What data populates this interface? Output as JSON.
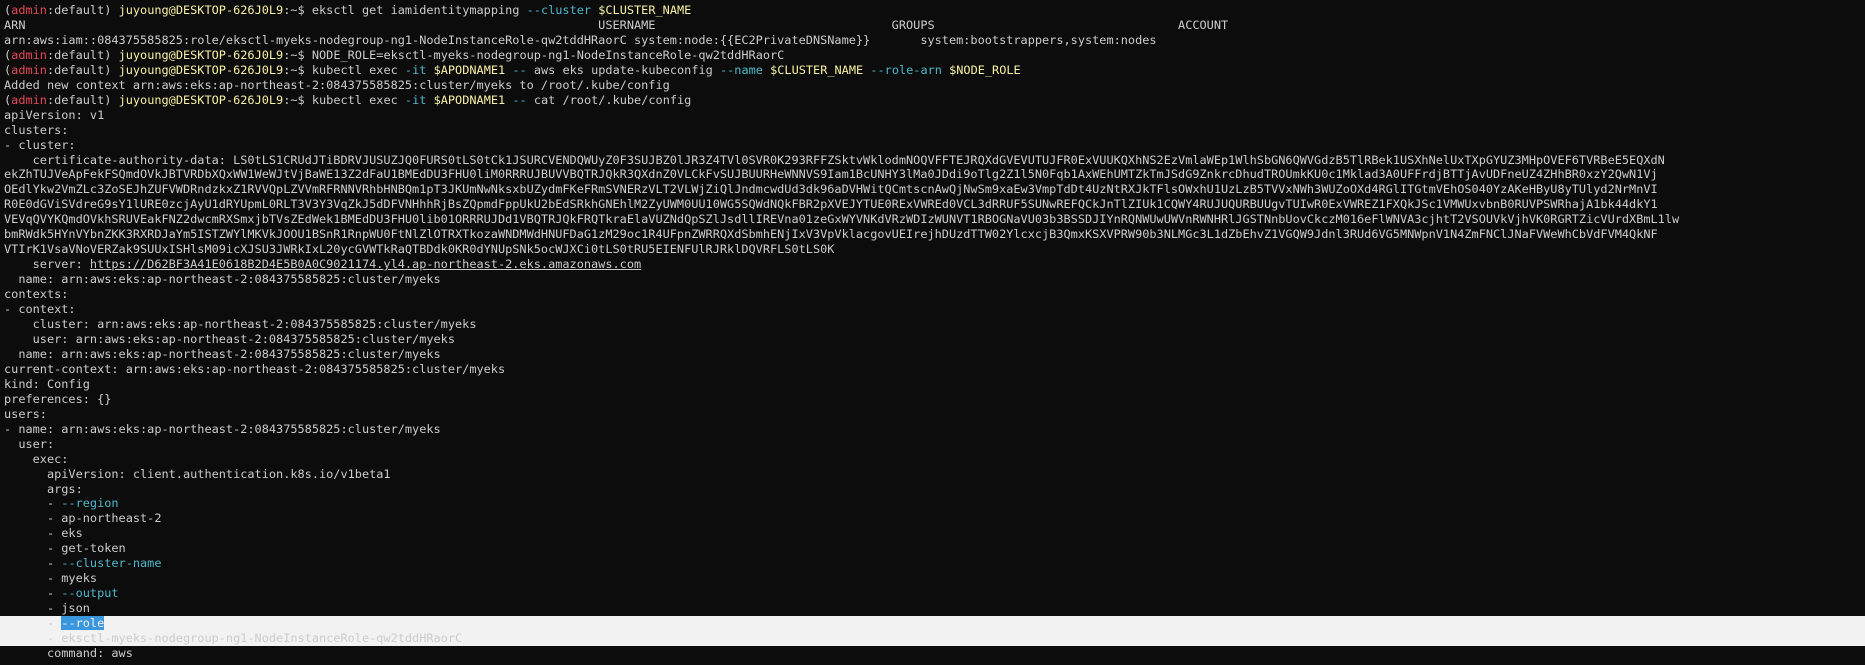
{
  "terminal": {
    "colors": {
      "background": "#0c0c0c",
      "foreground": "#cccccc",
      "prompt_env": "#e74856",
      "prompt_user": "#f9f1a5",
      "variable": "#f9f1a5",
      "flag": "#3a96dd",
      "selection": "#f2f2f2"
    },
    "lines": [
      {
        "segs": [
          {
            "t": "(",
            "c": "grey"
          },
          {
            "t": "admin",
            "c": "red"
          },
          {
            "t": ":default) ",
            "c": "grey"
          },
          {
            "t": "juyoung@DESKTOP-626J0L9",
            "c": "yellow"
          },
          {
            "t": ":~$ eksctl get iamidentitymapping ",
            "c": "grey"
          },
          {
            "t": "--cluster",
            "c": "teal"
          },
          {
            "t": " ",
            "c": "grey"
          },
          {
            "t": "$CLUSTER_NAME",
            "c": "yellow"
          }
        ]
      },
      {
        "segs": [
          {
            "t": "ARN                                                                                USERNAME                                 GROUPS                                  ACCOUNT",
            "c": "grey"
          }
        ]
      },
      {
        "segs": [
          {
            "t": "arn:aws:iam::084375585825:role/eksctl-myeks-nodegroup-ng1-NodeInstanceRole-qw2tddHRaorC system:node:{{EC2PrivateDNSName}}       system:bootstrappers,system:nodes",
            "c": "grey"
          }
        ]
      },
      {
        "segs": [
          {
            "t": "(",
            "c": "grey"
          },
          {
            "t": "admin",
            "c": "red"
          },
          {
            "t": ":default) ",
            "c": "grey"
          },
          {
            "t": "juyoung@DESKTOP-626J0L9",
            "c": "yellow"
          },
          {
            "t": ":~$ NODE_ROLE=eksctl-myeks-nodegroup-ng1-NodeInstanceRole-qw2tddHRaorC",
            "c": "grey"
          }
        ]
      },
      {
        "segs": [
          {
            "t": "(",
            "c": "grey"
          },
          {
            "t": "admin",
            "c": "red"
          },
          {
            "t": ":default) ",
            "c": "grey"
          },
          {
            "t": "juyoung@DESKTOP-626J0L9",
            "c": "yellow"
          },
          {
            "t": ":~$ kubectl exec ",
            "c": "grey"
          },
          {
            "t": "-it",
            "c": "teal"
          },
          {
            "t": " ",
            "c": "grey"
          },
          {
            "t": "$APODNAME1",
            "c": "yellow"
          },
          {
            "t": " ",
            "c": "grey"
          },
          {
            "t": "--",
            "c": "teal"
          },
          {
            "t": " aws eks update-kubeconfig ",
            "c": "grey"
          },
          {
            "t": "--name",
            "c": "teal"
          },
          {
            "t": " ",
            "c": "grey"
          },
          {
            "t": "$CLUSTER_NAME",
            "c": "yellow"
          },
          {
            "t": " ",
            "c": "grey"
          },
          {
            "t": "--role-arn",
            "c": "teal"
          },
          {
            "t": " ",
            "c": "grey"
          },
          {
            "t": "$NODE_ROLE",
            "c": "yellow"
          }
        ]
      },
      {
        "segs": [
          {
            "t": "Added new context arn:aws:eks:ap-northeast-2:084375585825:cluster/myeks to /root/.kube/config",
            "c": "grey"
          }
        ]
      },
      {
        "segs": [
          {
            "t": "(",
            "c": "grey"
          },
          {
            "t": "admin",
            "c": "red"
          },
          {
            "t": ":default) ",
            "c": "grey"
          },
          {
            "t": "juyoung@DESKTOP-626J0L9",
            "c": "yellow"
          },
          {
            "t": ":~$ kubectl exec ",
            "c": "grey"
          },
          {
            "t": "-it",
            "c": "teal"
          },
          {
            "t": " ",
            "c": "grey"
          },
          {
            "t": "$APODNAME1",
            "c": "yellow"
          },
          {
            "t": " ",
            "c": "grey"
          },
          {
            "t": "--",
            "c": "teal"
          },
          {
            "t": " cat /root/.kube/config",
            "c": "grey"
          }
        ]
      },
      {
        "segs": [
          {
            "t": "apiVersion: v1",
            "c": "grey"
          }
        ]
      },
      {
        "segs": [
          {
            "t": "clusters:",
            "c": "grey"
          }
        ]
      },
      {
        "segs": [
          {
            "t": "- cluster:",
            "c": "grey"
          }
        ]
      },
      {
        "segs": [
          {
            "t": "    certificate-authority-data: LS0tLS1CRUdJTiBDRVJUSUZJQ0FURS0tLS0tCk1JSURCVENDQWUyZ0F3SUJBZ0lJR3Z4TVl0SVR0K293RFFZSktvWklodmNOQVFFTEJRQXdGVEVUTUJFR0ExVUUKQXhNS2EzVmlaWEp1WlhSbGN6QWVGdzB5TlRBek1USXhNelUxTXpGYUZ3MHpOVEF6TVRBeE5EQXdN",
            "c": "grey"
          }
        ]
      },
      {
        "segs": [
          {
            "t": "ekZhTUJVeApFekFSQmdOVkJBTVRDbXQxWW1WeWJtVjBaWE13Z2dFaU1BMEdDU3FHU0liM0RRRUJBUVVBQTRJQkR3QXdnZ0VLCkFvSUJBUURHeWNNVS9Iam1BcUNHY3lMa0JDdi9oTlg2Z1l5N0Fqb1AxWEhUMTZkTmJSdG9ZnkrcDhudTROUmkKU0c1Mklad3A0UFFrdjBTTjAvUDFneUZ4ZHhBR0xzY2QwN1Vj",
            "c": "grey"
          }
        ]
      },
      {
        "segs": [
          {
            "t": "OEdlYkw2VmZLc3ZoSEJhZUFVWDRndzkxZ1RVVQpLZVVmRFRNNVRhbHNBQm1pT3JKUmNwNksxbUZydmFKeFRmSVNERzVLT2VLWjZiQlJndmcwdUd3dk96aDVHWitQCmtscnAwQjNwSm9xaEw3VmpTdDt4UzNtRXJkTFlsOWxhU1UzLzB5TVVxNWh3WUZoOXd4RGlITGtmVEhOS040YzAKeHByU8yTUlyd2NrMnVI",
            "c": "grey"
          }
        ]
      },
      {
        "segs": [
          {
            "t": "R0E0dGViSVdreG9sY1lURE0zcjAyU1dRYUpmL0RLT3V3Y3VqZkJ5dDFVNHhhRjBsZQpmdFppUkU2bEdSRkhGNEhlM2ZyUWM0UU10WG5SQWdNQkFBR2pXVEJYTUE0RExVWREd0VCL3dRRUF5SUNwREFQCkJnTlZIUk1CQWY4RUJUQURBUUgvTUIwR0ExVWREZ1FXQkJSc1VMWUxvbnB0RUVPSWRhajA1bk44dkY1",
            "c": "grey"
          }
        ]
      },
      {
        "segs": [
          {
            "t": "VEVqQVYKQmdOVkhSRUVEakFNZ2dwcmRXSmxjbTVsZEdWek1BMEdDU3FHU0lib01ORRRUJDd1VBQTRJQkFRQTkraElaVUZNdQpSZlJsdllIREVna01zeGxWYVNKdVRzWDIzWUNVT1RBOGNaVU03b3BSSDJIYnRQNWUwUWVnRWNHRlJGSTNnbUovCkczM016eFlWNVA3cjhtT2VSOUVkVjhVK0RGRTZicVUrdXBmL1lw",
            "c": "grey"
          }
        ]
      },
      {
        "segs": [
          {
            "t": "bmRWdk5HYnVYbnZKK3RXRDJaYm5ISTZWYlMKVkJOOU1BSnR1RnpWU0FtNlZlOTRXTkozaWNDMWdHNUFDaG1zM29oc1R4UFpnZWRRQXdSbmhENjIxV3VpVklacgovUEIrejhDUzdTTW02YlcxcjB3QmxKSXVPRW90b3NLMGc3L1dZbEhvZ1VGQW9Jdnl3RUd6VG5MNWpnV1N4ZmFNClJNaFVWeWhCbVdFVM4QkNF",
            "c": "grey"
          }
        ]
      },
      {
        "segs": [
          {
            "t": "VTIrK1VsaVNoVERZak9SUUxISHlsM09icXJSU3JWRkIxL20ycGVWTkRaQTBDdk0KR0dYNUpSNk5ocWJXCi0tLS0tRU5EIENFUlRJRklDQVRFLS0tLS0K",
            "c": "grey"
          }
        ]
      },
      {
        "segs": [
          {
            "t": "    server: ",
            "c": "grey"
          },
          {
            "t": "https://D62BF3A41E0618B2D4E5B0A0C9021174.yl4.ap-northeast-2.eks.amazonaws.com",
            "c": "link"
          }
        ]
      },
      {
        "segs": [
          {
            "t": "  name: arn:aws:eks:ap-northeast-2:084375585825:cluster/myeks",
            "c": "grey"
          }
        ]
      },
      {
        "segs": [
          {
            "t": "contexts:",
            "c": "grey"
          }
        ]
      },
      {
        "segs": [
          {
            "t": "- context:",
            "c": "grey"
          }
        ]
      },
      {
        "segs": [
          {
            "t": "    cluster: arn:aws:eks:ap-northeast-2:084375585825:cluster/myeks",
            "c": "grey"
          }
        ]
      },
      {
        "segs": [
          {
            "t": "    user: arn:aws:eks:ap-northeast-2:084375585825:cluster/myeks",
            "c": "grey"
          }
        ]
      },
      {
        "segs": [
          {
            "t": "  name: arn:aws:eks:ap-northeast-2:084375585825:cluster/myeks",
            "c": "grey"
          }
        ]
      },
      {
        "segs": [
          {
            "t": "current-context: arn:aws:eks:ap-northeast-2:084375585825:cluster/myeks",
            "c": "grey"
          }
        ]
      },
      {
        "segs": [
          {
            "t": "kind: Config",
            "c": "grey"
          }
        ]
      },
      {
        "segs": [
          {
            "t": "preferences: {}",
            "c": "grey"
          }
        ]
      },
      {
        "segs": [
          {
            "t": "users:",
            "c": "grey"
          }
        ]
      },
      {
        "segs": [
          {
            "t": "- name: arn:aws:eks:ap-northeast-2:084375585825:cluster/myeks",
            "c": "grey"
          }
        ]
      },
      {
        "segs": [
          {
            "t": "  user:",
            "c": "grey"
          }
        ]
      },
      {
        "segs": [
          {
            "t": "    exec:",
            "c": "grey"
          }
        ]
      },
      {
        "segs": [
          {
            "t": "      apiVersion: client.authentication.k8s.io/v1beta1",
            "c": "grey"
          }
        ]
      },
      {
        "segs": [
          {
            "t": "      args:",
            "c": "grey"
          }
        ]
      },
      {
        "segs": [
          {
            "t": "      - ",
            "c": "grey"
          },
          {
            "t": "--region",
            "c": "teal"
          }
        ]
      },
      {
        "segs": [
          {
            "t": "      - ap-northeast-2",
            "c": "grey"
          }
        ]
      },
      {
        "segs": [
          {
            "t": "      - eks",
            "c": "grey"
          }
        ]
      },
      {
        "segs": [
          {
            "t": "      - get-token",
            "c": "grey"
          }
        ]
      },
      {
        "segs": [
          {
            "t": "      - ",
            "c": "grey"
          },
          {
            "t": "--cluster-name",
            "c": "teal"
          }
        ]
      },
      {
        "segs": [
          {
            "t": "      - myeks",
            "c": "grey"
          }
        ]
      },
      {
        "segs": [
          {
            "t": "      - ",
            "c": "grey"
          },
          {
            "t": "--output",
            "c": "teal"
          }
        ]
      },
      {
        "segs": [
          {
            "t": "      - json",
            "c": "grey"
          }
        ]
      },
      {
        "sel": true,
        "segs": [
          {
            "t": "      - ",
            "c": "grey"
          },
          {
            "t": "--role",
            "c": "hl"
          }
        ]
      },
      {
        "sel": true,
        "segs": [
          {
            "t": "      - eksctl-myeks-nodegroup-ng1-NodeInstanceRole-qw2tddHRaorC",
            "c": "grey"
          }
        ]
      },
      {
        "segs": [
          {
            "t": "      command: aws",
            "c": "grey"
          }
        ]
      }
    ]
  }
}
